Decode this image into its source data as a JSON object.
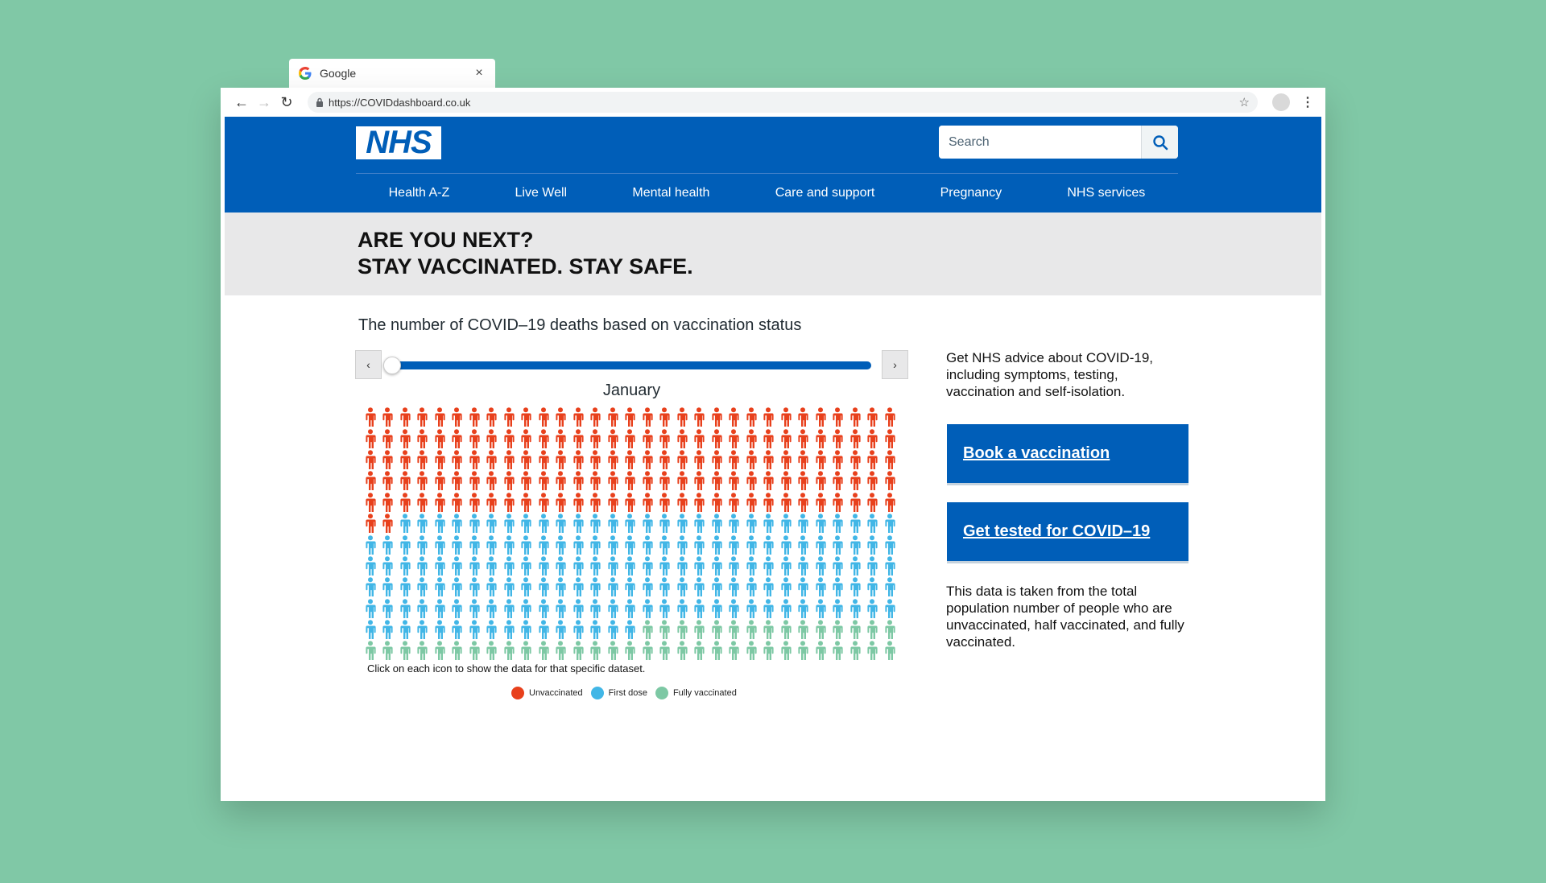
{
  "browser": {
    "tab_title": "Google",
    "tab_close": "×",
    "url": "https://COVIDdashboard.co.uk"
  },
  "header": {
    "logo_text": "NHS",
    "search_placeholder": "Search",
    "nav": [
      "Health A-Z",
      "Live Well",
      "Mental health",
      "Care and support",
      "Pregnancy",
      "NHS services"
    ]
  },
  "hero": {
    "line1": "ARE YOU NEXT?",
    "line2": "STAY VACCINATED. STAY SAFE."
  },
  "main": {
    "chart_title": "The number of COVID–19 deaths based on vaccination status",
    "month": "January",
    "slider_position": 0,
    "grid_caption": "Click on each icon to show the data for that specific dataset.",
    "prev_label": "‹",
    "next_label": "›"
  },
  "chart_data": {
    "type": "table",
    "title": "The number of COVID–19 deaths based on vaccination status",
    "period": "January",
    "icon_grid": {
      "columns": 31,
      "rows": 12
    },
    "series": [
      {
        "name": "Unvaccinated",
        "count": 157,
        "color": "#e8401c"
      },
      {
        "name": "First dose",
        "count": 169,
        "color": "#41b6e6"
      },
      {
        "name": "Fully vaccinated",
        "count": 46,
        "color": "#7dc8a4"
      }
    ]
  },
  "sidebar": {
    "advice": "Get NHS advice about COVID-19, including symptoms, testing, vaccination and self-isolation.",
    "cta_book": "Book a vaccination",
    "cta_test": "Get tested for COVID–19",
    "note": "This data is taken from the total population number of people who are unvaccinated, half vaccinated, and fully vaccinated."
  },
  "colors": {
    "nhs_blue": "#005eb8",
    "page_bg": "#80c8a6",
    "hero_bg": "#e8e8e9"
  }
}
